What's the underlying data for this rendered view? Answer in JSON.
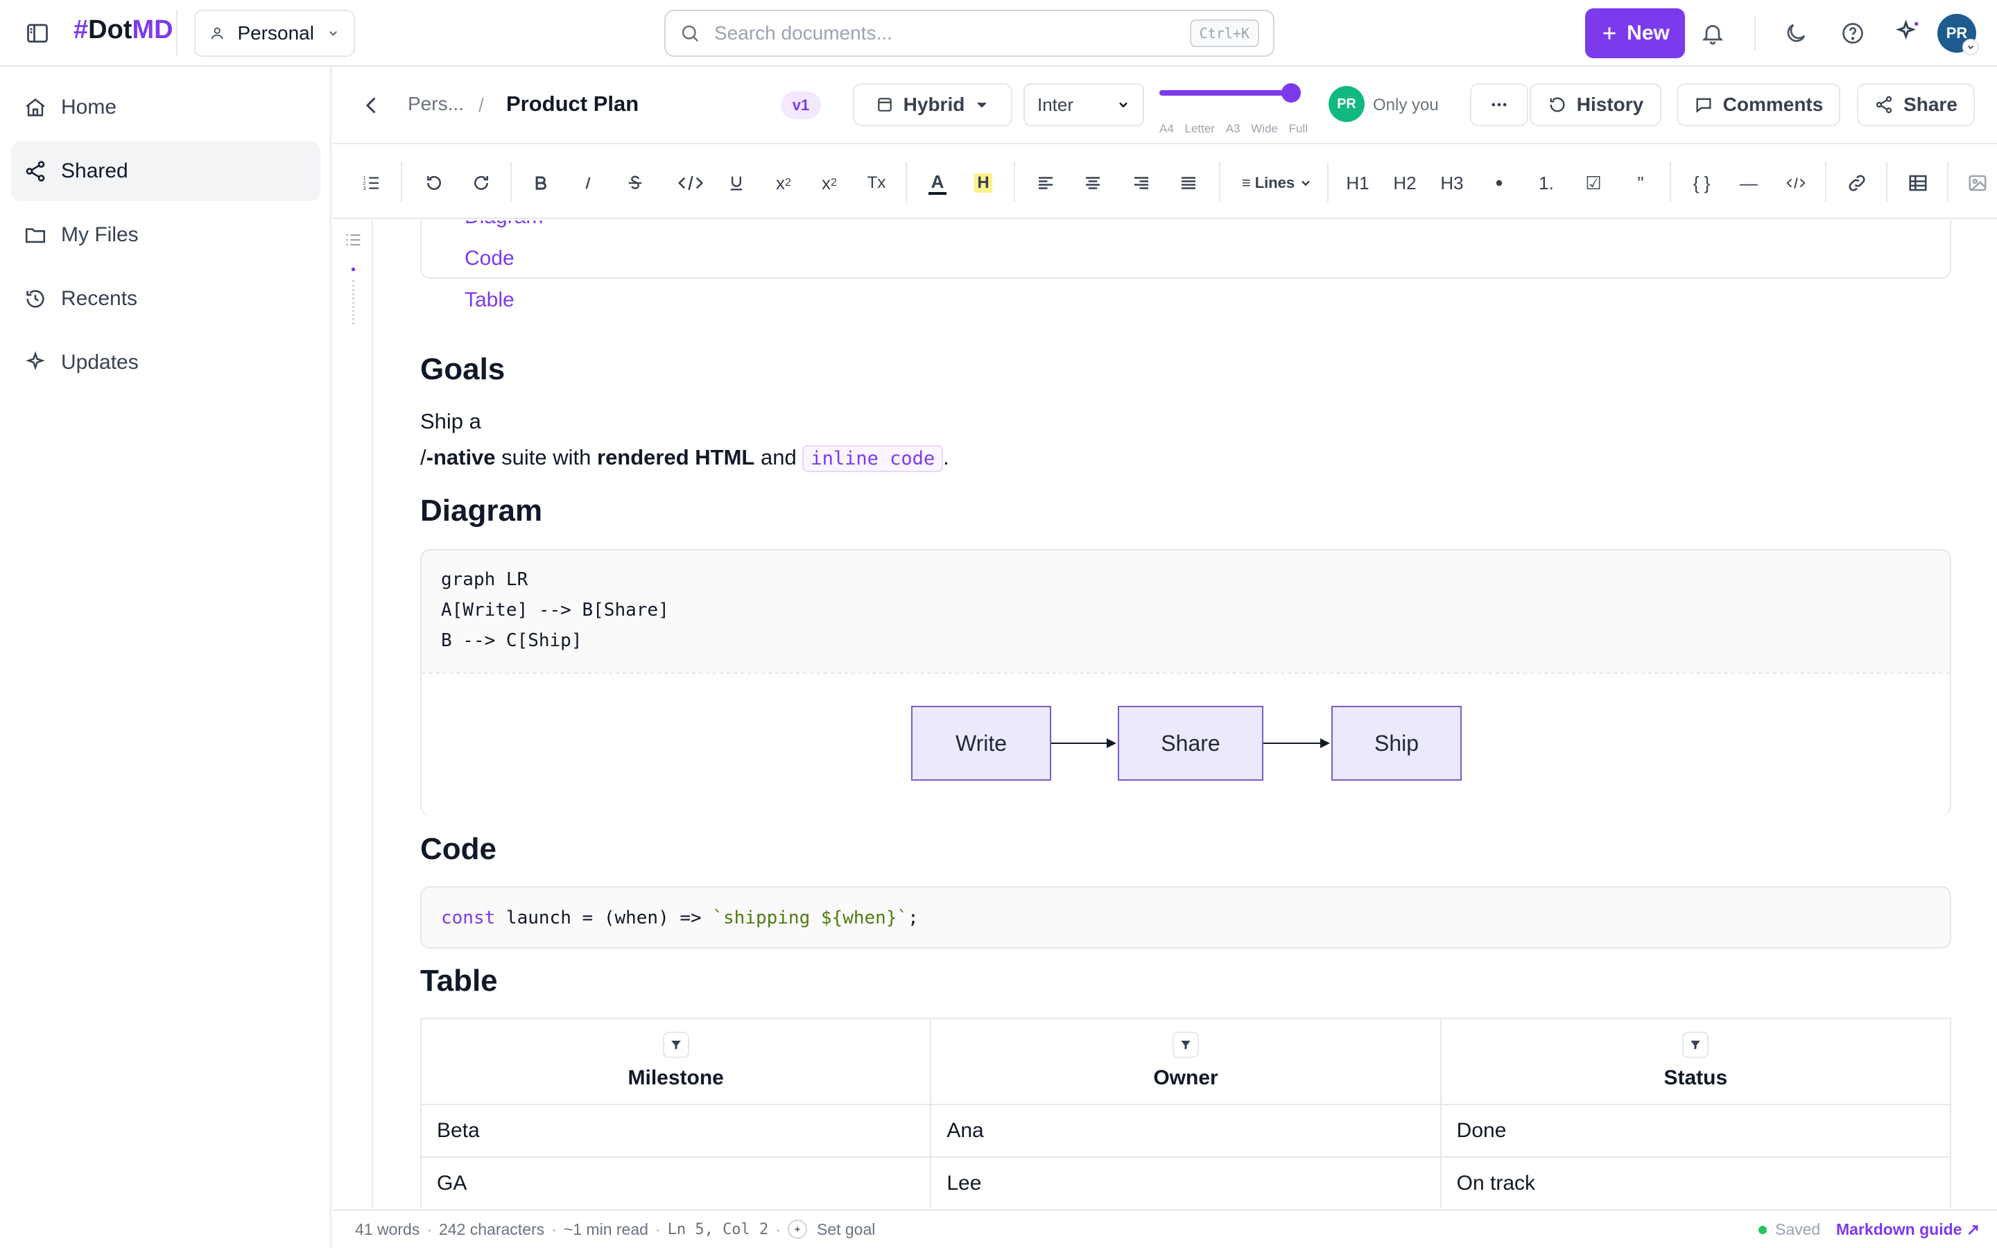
{
  "app": {
    "logo_hash": "#",
    "logo_dot": "Dot",
    "logo_md": "MD",
    "workspace": "Personal",
    "search_placeholder": "Search documents...",
    "search_shortcut": "Ctrl+K",
    "new_label": "New",
    "avatar_initials": "PR",
    "accent": "#7c3aed"
  },
  "sidebar": {
    "items": [
      {
        "label": "Home",
        "icon": "home-icon",
        "active": false
      },
      {
        "label": "Shared",
        "icon": "share-nodes-icon",
        "active": true
      },
      {
        "label": "My Files",
        "icon": "folder-icon",
        "active": false
      },
      {
        "label": "Recents",
        "icon": "history-icon",
        "active": false
      },
      {
        "label": "Updates",
        "icon": "sparkle-icon",
        "active": false
      }
    ]
  },
  "doc_header": {
    "breadcrumb_parent": "Pers...",
    "breadcrumb_sep": "/",
    "title": "Product Plan",
    "version": "v1",
    "view_mode": "Hybrid",
    "font": "Inter",
    "width_labels": [
      "A4",
      "Letter",
      "A3",
      "Wide",
      "Full"
    ],
    "width_level": 1.0,
    "presence_initials": "PR",
    "presence_label": "Only you",
    "history_label": "History",
    "comments_label": "Comments",
    "share_label": "Share"
  },
  "toolbar": {
    "superscript": "x",
    "superscript_sup": "2",
    "subscript": "x",
    "subscript_sub": "2",
    "clear_format": "Tx",
    "text_color": "A",
    "highlight": "H",
    "line_spacing": "Lines",
    "h1": "H1",
    "h2": "H2",
    "h3": "H3",
    "ordered_list": "1.",
    "checklist": "☑",
    "quote": "\"",
    "code_block": "{ }",
    "divider": "—"
  },
  "document": {
    "toc": [
      "Diagram",
      "Code",
      "Table"
    ],
    "goals_heading": "Goals",
    "goals_line1": "Ship a",
    "goals_prefix": "/",
    "goals_bold1": "-native",
    "goals_mid": " suite with ",
    "goals_bold2": "rendered HTML",
    "goals_and": " and ",
    "goals_code": "inline code",
    "goals_end": ".",
    "diagram_heading": "Diagram",
    "diagram_source": [
      "graph LR",
      "A[Write] --> B[Share]",
      "B --> C[Ship]"
    ],
    "diagram_nodes": [
      "Write",
      "Share",
      "Ship"
    ],
    "code_heading": "Code",
    "code_kw": "const",
    "code_mid": " launch = (when) => ",
    "code_str": "`shipping ${when}`",
    "code_end": ";",
    "table_heading": "Table",
    "table_headers": [
      "Milestone",
      "Owner",
      "Status"
    ],
    "table_rows": [
      [
        "Beta",
        "Ana",
        "Done"
      ],
      [
        "GA",
        "Lee",
        "On track"
      ]
    ]
  },
  "status": {
    "words": "41 words",
    "chars": "242 characters",
    "read": "~1 min read",
    "cursor": "Ln 5, Col 2",
    "goal": "Set goal",
    "saved": "Saved",
    "guide": "Markdown guide ↗"
  }
}
